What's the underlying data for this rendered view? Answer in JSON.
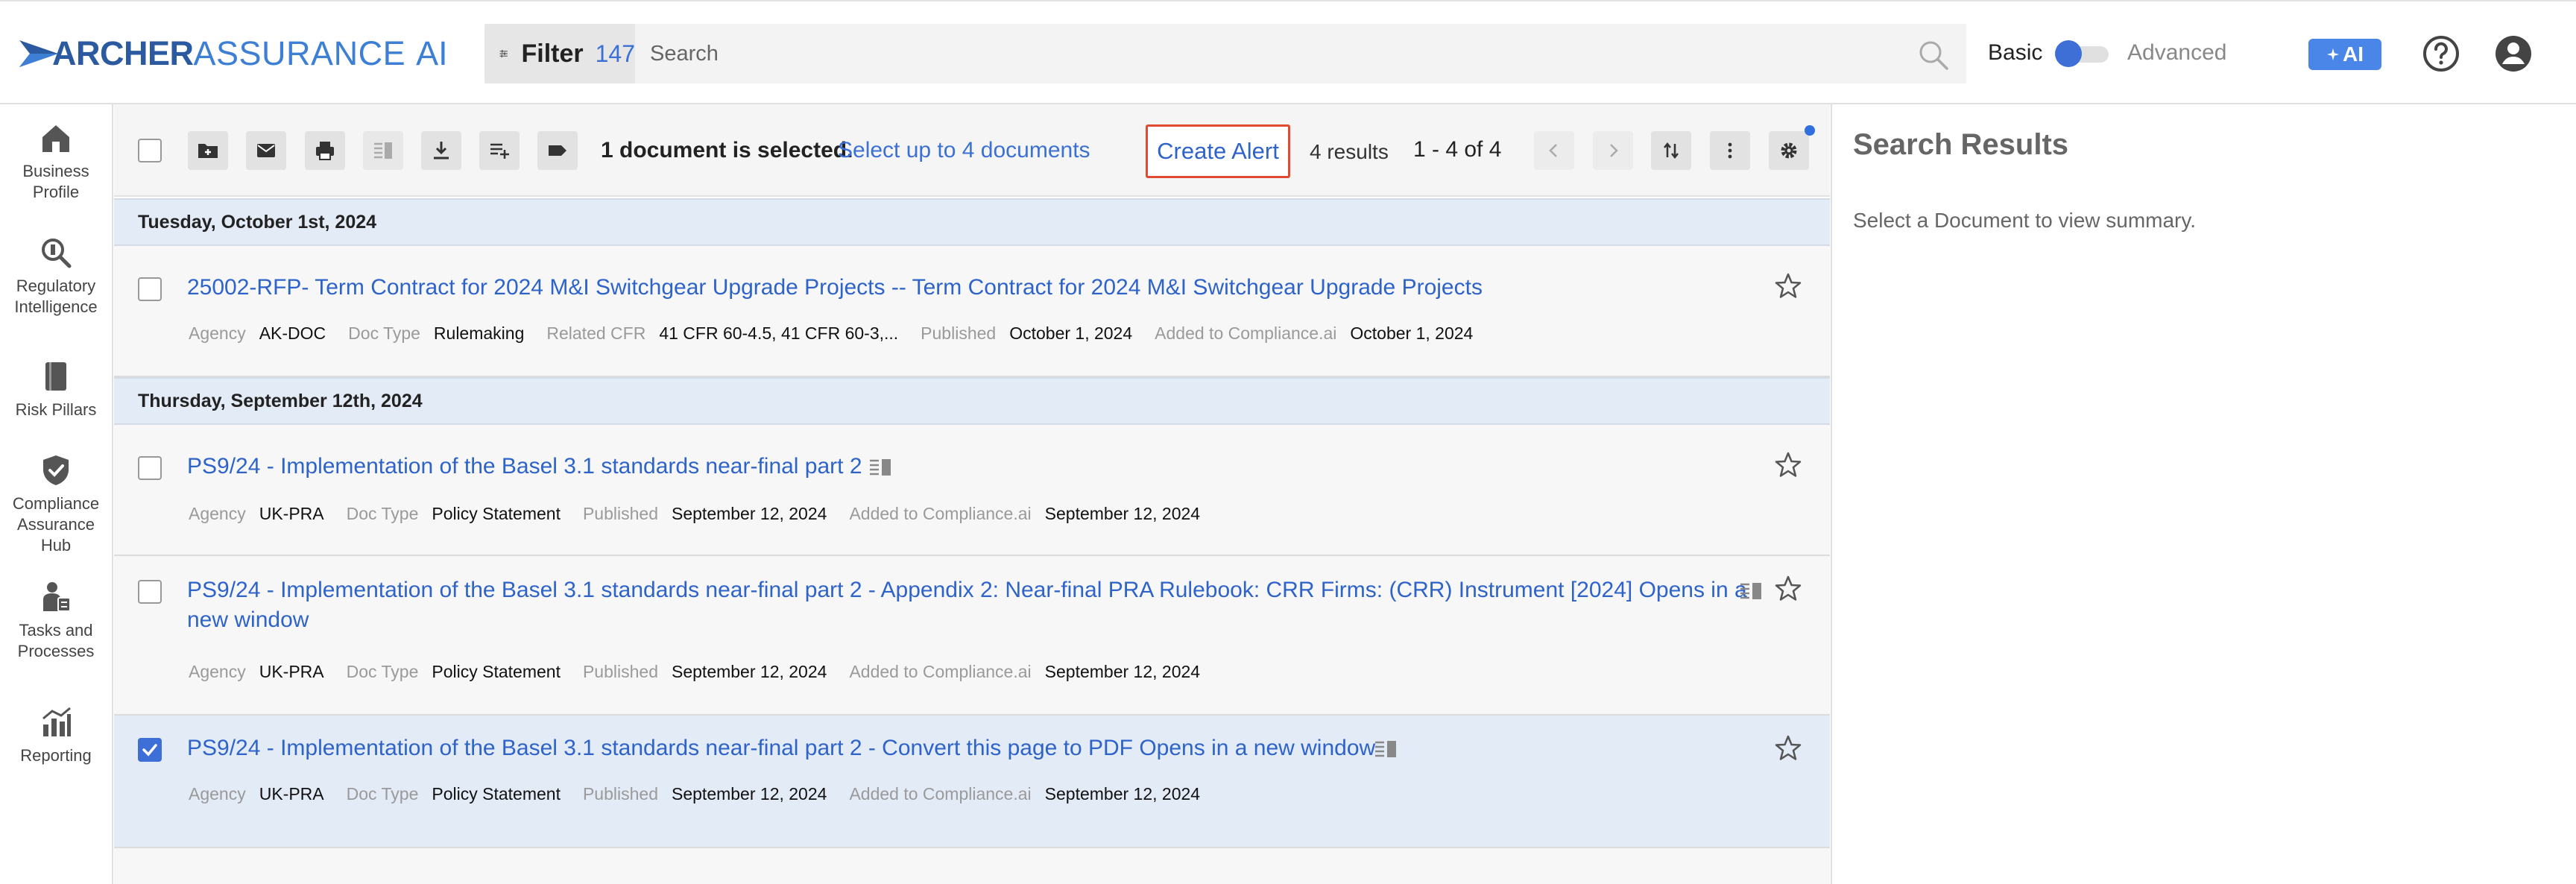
{
  "header": {
    "logo": {
      "archer": "ARCHER",
      "assurance": "ASSURANCE",
      "ai": "AI"
    },
    "filter": {
      "label": "Filter",
      "count": "147"
    },
    "search": {
      "placeholder": "Search"
    },
    "mode": {
      "basic": "Basic",
      "advanced": "Advanced",
      "advanced_on": false
    },
    "ai_button": "AI"
  },
  "nav": {
    "items": [
      {
        "label": "Business Profile",
        "icon": "building-icon"
      },
      {
        "label": "Regulatory Intelligence",
        "icon": "search-icon"
      },
      {
        "label": "Risk Pillars",
        "icon": "book-icon"
      },
      {
        "label": "Compliance Assurance Hub",
        "icon": "shield-check-icon"
      },
      {
        "label": "Tasks and Processes",
        "icon": "person-task-icon"
      },
      {
        "label": "Reporting",
        "icon": "chart-icon"
      }
    ]
  },
  "toolbar": {
    "selected_msg": "1 document is selected.",
    "select_up": "Select up to 4 documents",
    "create_alert": "Create Alert",
    "results_count": "4 results",
    "pagination": "1 - 4 of 4"
  },
  "groups": [
    {
      "date": "Tuesday, October 1st, 2024"
    },
    {
      "date": "Thursday, September 12th, 2024"
    }
  ],
  "labels": {
    "agency": "Agency",
    "doc_type": "Doc Type",
    "related_cfr": "Related CFR",
    "published": "Published",
    "added": "Added to Compliance.ai"
  },
  "docs": [
    {
      "title": "25002-RFP- Term Contract for 2024 M&I Switchgear Upgrade Projects -- Term Contract for 2024 M&I Switchgear Upgrade Projects",
      "agency": "AK-DOC",
      "doc_type": "Rulemaking",
      "related_cfr": "41 CFR 60-4.5, 41 CFR 60-3,...",
      "published": "October 1, 2024",
      "added": "October 1, 2024",
      "checked": false
    },
    {
      "title": "PS9/24 - Implementation of the Basel 3.1 standards near-final part 2",
      "agency": "UK-PRA",
      "doc_type": "Policy Statement",
      "published": "September 12, 2024",
      "added": "September 12, 2024",
      "checked": false
    },
    {
      "title_line1": "PS9/24 - Implementation of the Basel 3.1 standards near-final part 2 - Appendix 2: Near-final PRA Rulebook: CRR Firms: (CRR) Instrument [2024] Opens in a",
      "title_line2": "new window",
      "agency": "UK-PRA",
      "doc_type": "Policy Statement",
      "published": "September 12, 2024",
      "added": "September 12, 2024",
      "checked": false
    },
    {
      "title": "PS9/24 - Implementation of the Basel 3.1 standards near-final part 2 - Convert this page to PDF Opens in a new window",
      "agency": "UK-PRA",
      "doc_type": "Policy Statement",
      "published": "September 12, 2024",
      "added": "September 12, 2024",
      "checked": true
    }
  ],
  "right_panel": {
    "title": "Search Results",
    "message": "Select a Document to view summary."
  },
  "colors": {
    "accent": "#3d6fd6",
    "link": "#2e63c9",
    "alert_border": "#e04b32",
    "selected_row": "#e3ebf7"
  }
}
